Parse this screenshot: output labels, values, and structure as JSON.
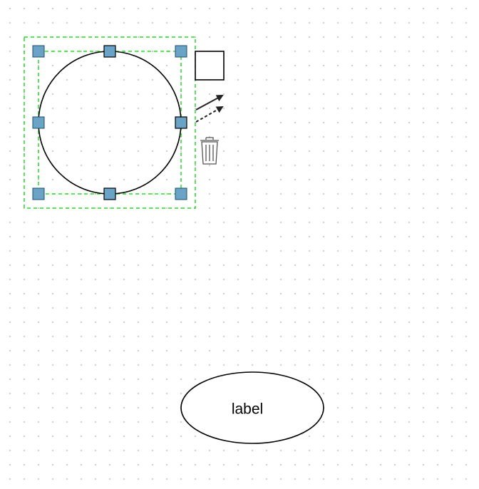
{
  "diagram": {
    "nodes": [
      {
        "shape": "circle",
        "selected": true
      },
      {
        "shape": "ellipse",
        "label": "label"
      }
    ],
    "selection_color": "#22dd22",
    "handle_color": "#6aa3c6",
    "toolbar": {
      "items": [
        "square-shape-icon",
        "arrow-solid-icon",
        "arrow-dashed-icon",
        "trash-icon"
      ]
    }
  }
}
